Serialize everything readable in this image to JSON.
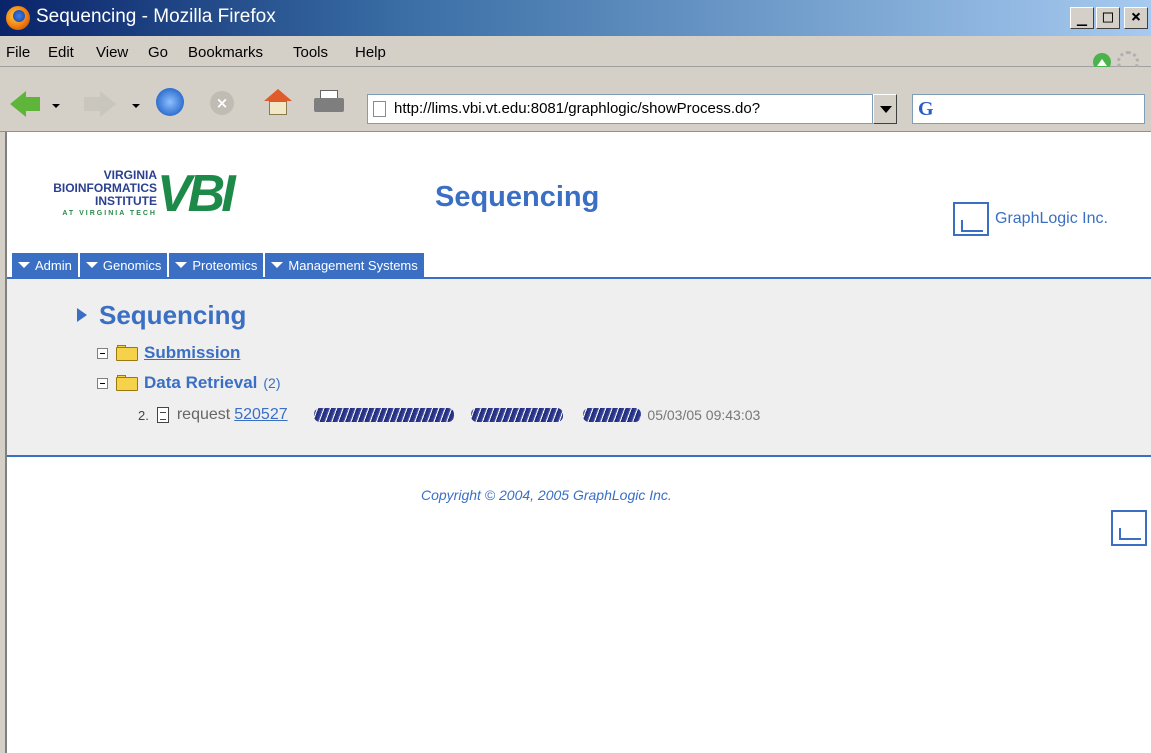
{
  "window": {
    "title": "Sequencing - Mozilla Firefox"
  },
  "menu": [
    "File",
    "Edit",
    "View",
    "Go",
    "Bookmarks",
    "Tools",
    "Help"
  ],
  "toolbar": {
    "url": "http://lims.vbi.vt.edu:8081/graphlogic/showProcess.do?",
    "search_engine_glyph": "G"
  },
  "header": {
    "logo_lines": [
      "VIRGINIA",
      "BIOINFORMATICS",
      "INSTITUTE",
      "AT VIRGINIA TECH"
    ],
    "logo_mark": "VBI",
    "title": "Sequencing",
    "company": "GraphLogic Inc."
  },
  "tabs": [
    "Admin",
    "Genomics",
    "Proteomics",
    "Management Systems"
  ],
  "process": {
    "title": "Sequencing",
    "nodes": [
      {
        "label": "Submission"
      },
      {
        "label": "Data Retrieval",
        "count": "(2)"
      }
    ],
    "request": {
      "index": "2.",
      "label": "request",
      "id": "520527",
      "timestamp": "05/03/05 09:43:03"
    }
  },
  "footer": {
    "copyright": "Copyright © 2004, 2005 GraphLogic Inc."
  },
  "colors": {
    "accent": "#3a6fc4",
    "panel": "#efefef",
    "chrome": "#d4d0c8"
  }
}
